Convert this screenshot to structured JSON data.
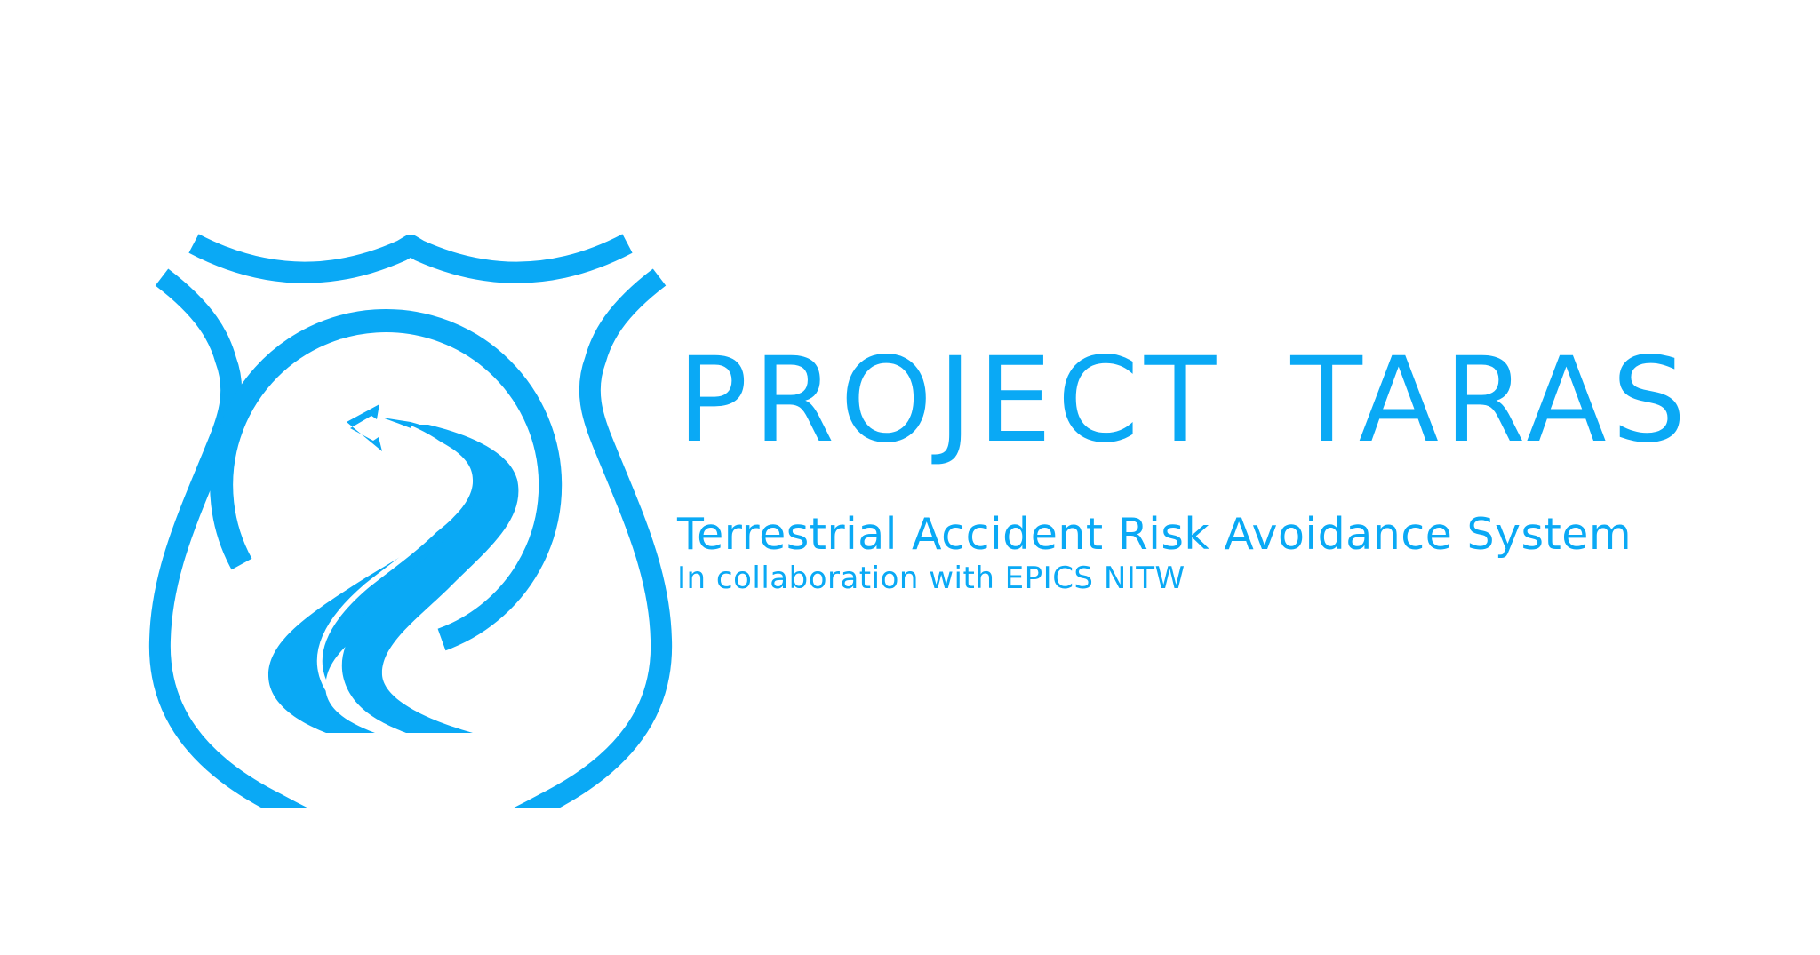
{
  "brand": {
    "title": "PROJECT TARAS",
    "subtitle": "Terrestrial Accident Risk Avoidance System",
    "collaboration": "In collaboration with EPICS NITW"
  },
  "logo": {
    "icon": "shield-road-icon",
    "color": "#0aa9f5"
  }
}
